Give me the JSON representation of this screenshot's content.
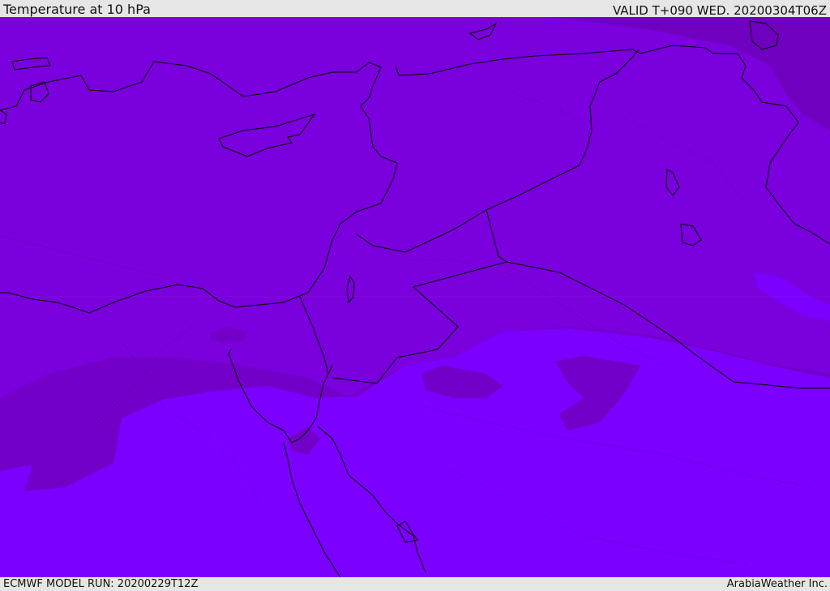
{
  "header": {
    "title": "Temperature at 10 hPa",
    "valid": "VALID T+090 WED. 20200304T06Z"
  },
  "footer": {
    "model_run": "ECMWF MODEL RUN: 20200229T12Z",
    "credit": "ArabiaWeather Inc."
  },
  "map": {
    "colors": {
      "warm_band": "#7a00dd",
      "mid_band": "#7300c8",
      "cold_band": "#7b00ff",
      "north_east_band": "#7000c0",
      "coastline": "#000000"
    }
  }
}
